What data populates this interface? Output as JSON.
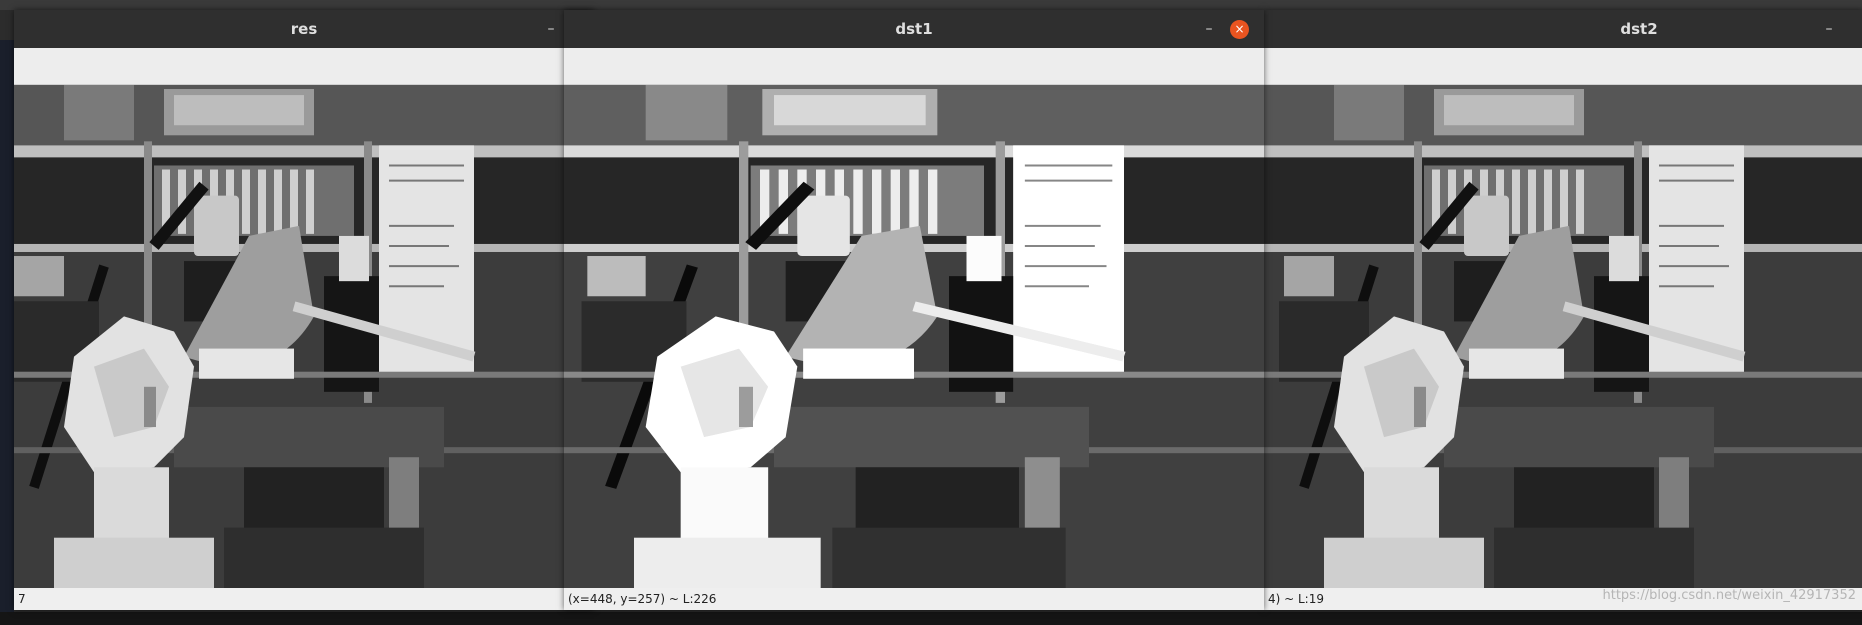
{
  "windows": {
    "res": {
      "title": "res",
      "minimize": "–",
      "close": "×",
      "status": "7"
    },
    "dst1": {
      "title": "dst1",
      "minimize": "–",
      "close": "×",
      "status": "(x=448, y=257) ~ L:226"
    },
    "dst2": {
      "title": "dst2",
      "minimize": "–",
      "status": "4) ~ L:19"
    }
  },
  "watermark": "https://blog.csdn.net/weixin_42917352",
  "icons": [
    "minimize-icon",
    "close-icon"
  ],
  "colors": {
    "close_button": "#e95420",
    "titlebar": "#2f2f2f",
    "toolbar": "#ededed"
  }
}
